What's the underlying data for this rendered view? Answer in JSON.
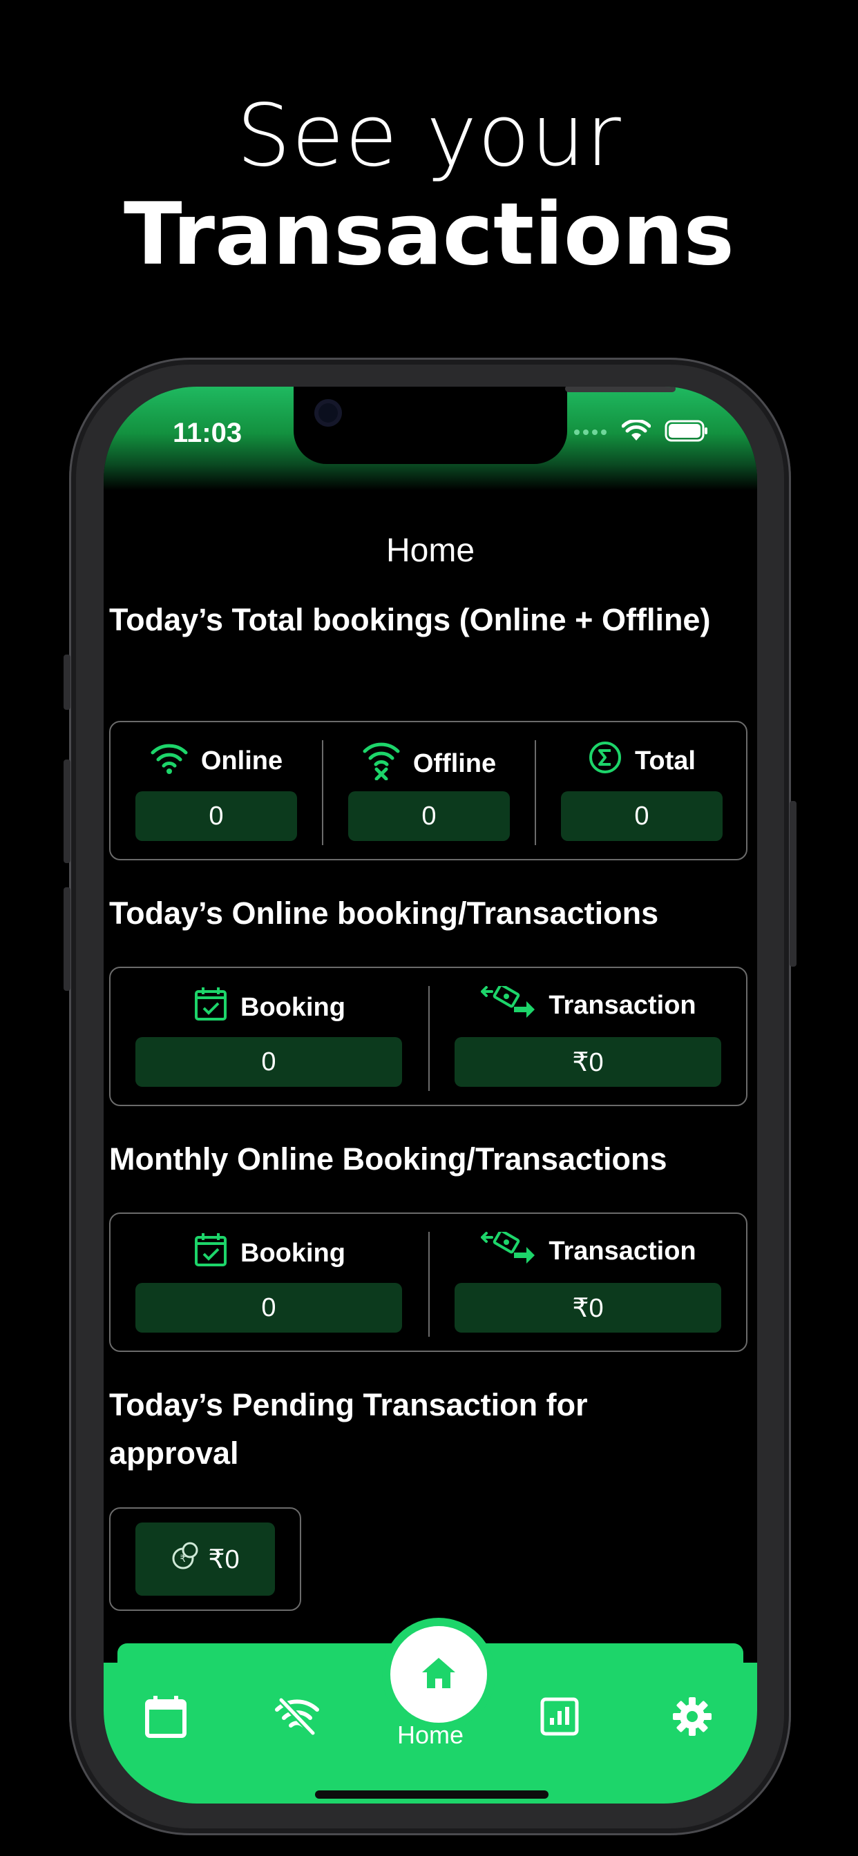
{
  "headline": {
    "line1": "See your",
    "line2": "Transactions"
  },
  "status_bar": {
    "time": "11:03",
    "icons": [
      "signal-dots-icon",
      "wifi-icon",
      "battery-icon"
    ]
  },
  "screen": {
    "title": "Home"
  },
  "sections": {
    "total_bookings": {
      "title": "Today’s Total bookings (Online + Offline)",
      "columns": [
        {
          "label": "Online",
          "icon": "wifi-icon",
          "value": "0"
        },
        {
          "label": "Offline",
          "icon": "wifi-off-icon",
          "value": "0"
        },
        {
          "label": "Total",
          "icon": "sigma-icon",
          "value": "0"
        }
      ]
    },
    "today_online": {
      "title": "Today’s Online booking/Transactions",
      "booking_label": "Booking",
      "booking_value": "0",
      "transaction_label": "Transaction",
      "transaction_value": "₹0"
    },
    "monthly_online": {
      "title": "Monthly Online Booking/Transactions",
      "booking_label": "Booking",
      "booking_value": "0",
      "transaction_label": "Transaction",
      "transaction_value": "₹0"
    },
    "pending": {
      "title": "Today’s Pending Transaction for approval",
      "value": "₹0"
    }
  },
  "bottom_nav": {
    "items": [
      "calendar-icon",
      "wifi-off-icon",
      "home-icon",
      "chart-icon",
      "gear-icon"
    ],
    "active_label": "Home"
  },
  "colors": {
    "accent": "#1dd56a",
    "value_box": "#0c3a1d",
    "background": "#000000"
  }
}
